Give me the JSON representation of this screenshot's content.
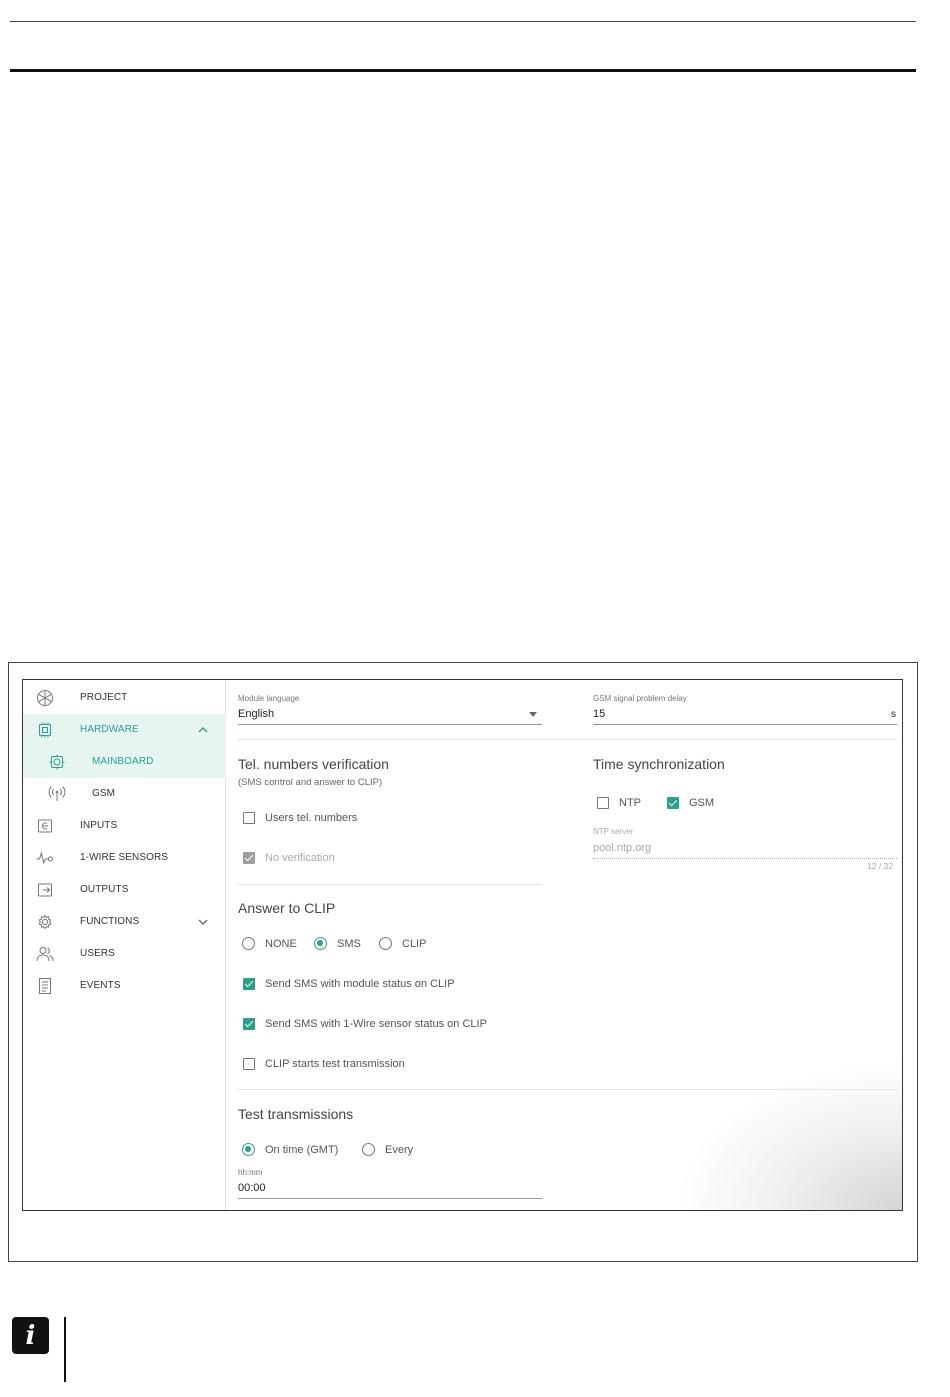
{
  "sidebar": {
    "items": [
      {
        "label": "PROJECT",
        "icon": "project-icon"
      },
      {
        "label": "HARDWARE",
        "icon": "hardware-icon",
        "active": true,
        "expanded": true
      },
      {
        "label": "MAINBOARD",
        "icon": "mainboard-icon",
        "sub": true,
        "active": true
      },
      {
        "label": "GSM",
        "icon": "gsm-antenna-icon",
        "sub": true
      },
      {
        "label": "INPUTS",
        "icon": "inputs-icon"
      },
      {
        "label": "1-WIRE SENSORS",
        "icon": "sensor-icon"
      },
      {
        "label": "OUTPUTS",
        "icon": "outputs-icon"
      },
      {
        "label": "FUNCTIONS",
        "icon": "gear-icon",
        "expanded": false
      },
      {
        "label": "USERS",
        "icon": "users-icon"
      },
      {
        "label": "EVENTS",
        "icon": "events-icon"
      }
    ]
  },
  "module_language": {
    "label": "Module language",
    "value": "English"
  },
  "gsm_delay": {
    "label": "GSM signal problem delay",
    "value": "15",
    "unit": "s"
  },
  "tel_verification": {
    "title": "Tel. numbers verification",
    "subtitle": "(SMS control and answer to CLIP)",
    "users_tel": {
      "label": "Users tel. numbers",
      "checked": false
    },
    "no_verification": {
      "label": "No verification",
      "checked": true,
      "disabled": true
    }
  },
  "time_sync": {
    "title": "Time synchronization",
    "ntp": {
      "label": "NTP",
      "checked": false
    },
    "gsm": {
      "label": "GSM",
      "checked": true
    },
    "ntp_server": {
      "label": "NTP server",
      "value": "pool.ntp.org",
      "counter": "12 / 32"
    }
  },
  "answer_clip": {
    "title": "Answer to CLIP",
    "options": [
      "NONE",
      "SMS",
      "CLIP"
    ],
    "selected": "SMS",
    "send_module_status": {
      "label": "Send SMS with module status on CLIP",
      "checked": true
    },
    "send_sensor_status": {
      "label": "Send SMS with 1-Wire sensor status on CLIP",
      "checked": true
    },
    "clip_test": {
      "label": "CLIP starts test transmission",
      "checked": false
    }
  },
  "test_transmissions": {
    "title": "Test transmissions",
    "options": [
      "On time (GMT)",
      "Every"
    ],
    "selected": "On time (GMT)",
    "time": {
      "label": "hh:mm",
      "value": "00:00"
    }
  },
  "colors": {
    "accent": "#2aa189",
    "active_bg": "#e6f5f2"
  },
  "info_icon": {
    "glyph": "i",
    "name": "info-icon"
  }
}
